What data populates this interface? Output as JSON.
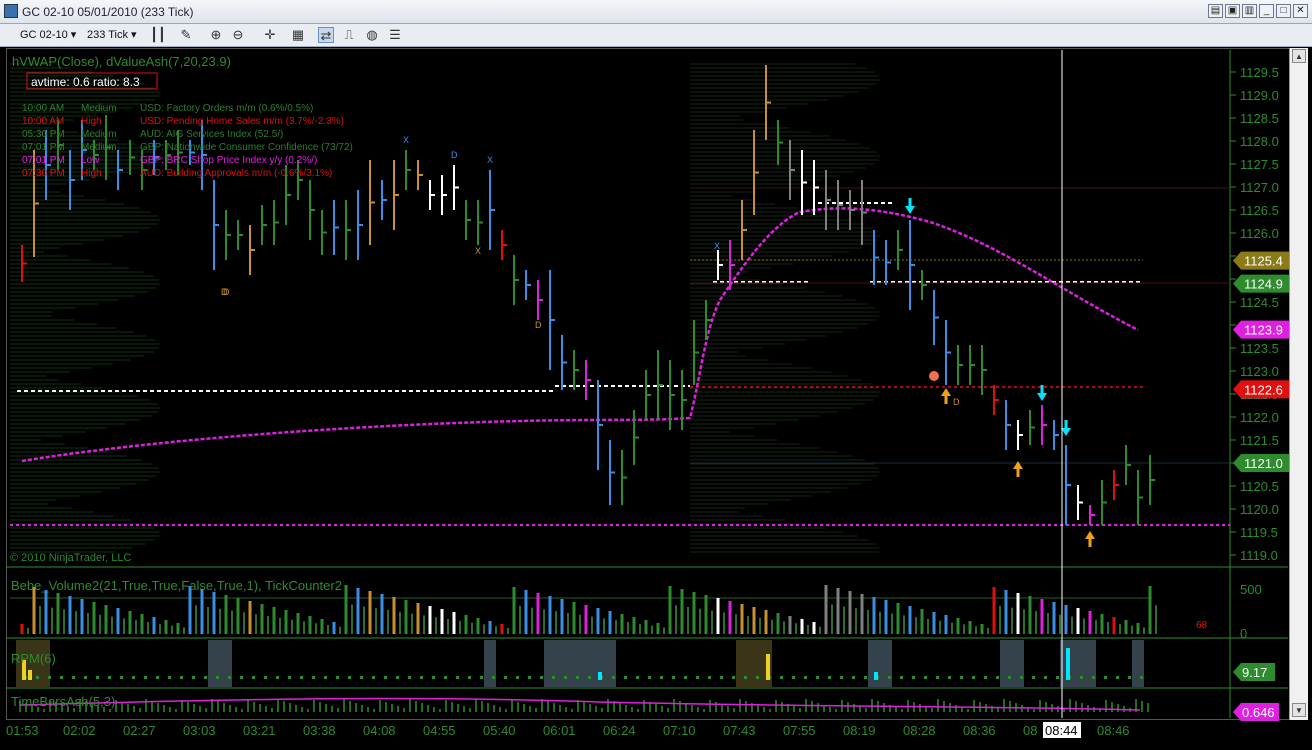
{
  "window": {
    "title": "GC 02-10  05/01/2010 (233 Tick)"
  },
  "toolbar": {
    "instrument": "GC 02-10",
    "interval": "233 Tick",
    "icons": [
      "bar-type-icon",
      "drawing-pencil-icon",
      "zoom-in-icon",
      "zoom-out-icon",
      "crosshair-icon",
      "properties-icon",
      "data-box-icon",
      "chart-trader-icon",
      "globe-icon",
      "strategy-icon"
    ]
  },
  "chart": {
    "indicator_title": "hVWAP(Close), dValueAsh(7,20,23.9)",
    "avtime_label": "avtime: 0.6 ratio: 8.3",
    "copyright": "© 2010 NinjaTrader, LLC",
    "news": [
      {
        "time": "10:00 AM",
        "impact": "Medium",
        "text": "USD: Factory Orders m/m (0.6%/0.5%)",
        "color": "#2e7d2e"
      },
      {
        "time": "10:00 AM",
        "impact": "High",
        "text": "USD: Pending Home Sales m/m (3.7%/-2.3%)",
        "color": "#e01010"
      },
      {
        "time": "05:30 PM",
        "impact": "Medium",
        "text": "AUD: AIG Services Index (52.5/)",
        "color": "#2e7d2e"
      },
      {
        "time": "07:01 PM",
        "impact": "Medium",
        "text": "GBP: Nationwide Consumer Confidence (73/72)",
        "color": "#2e7d2e"
      },
      {
        "time": "07:01 PM",
        "impact": "Low",
        "text": "GBP: BRC Shop Price Index y/y (0.2%/)",
        "color": "#e020e0"
      },
      {
        "time": "07:30 PM",
        "impact": "High",
        "text": "AUD: Building Approvals m/m (-0.6%/3.1%)",
        "color": "#e01010"
      }
    ],
    "price_ticks": [
      "1129.5",
      "1129.0",
      "1128.5",
      "1128.0",
      "1127.5",
      "1127.0",
      "1126.5",
      "1126.0",
      "1125.5",
      "1125.0",
      "1124.5",
      "1124.0",
      "1123.5",
      "1123.0",
      "1122.5",
      "1122.0",
      "1121.5",
      "1121.0",
      "1120.5",
      "1120.0",
      "1119.5",
      "1119.0"
    ],
    "price_markers": [
      {
        "value": "1125.4",
        "color": "#8a7a18"
      },
      {
        "value": "1124.9",
        "color": "#2e8b2e"
      },
      {
        "value": "1123.9",
        "color": "#e020e0"
      },
      {
        "value": "1122.6",
        "color": "#e01010"
      },
      {
        "value": "1121.0",
        "color": "#2e8b2e"
      }
    ],
    "letter_marks": [
      "D",
      "D",
      "D",
      "X",
      "X",
      "X",
      "D",
      "X",
      "D"
    ],
    "volume_panel_title": "Bebe_Volume2(21,True,True,False,True,1), TickCounter2",
    "volume_ticks": [
      "500",
      "0"
    ],
    "tick_counter": "68",
    "rpm_title": "RPM(6)",
    "rpm_value": "9.17",
    "timebars_title": "TimeBarsAsh(5,3)",
    "timebars_value": "0.646",
    "time_axis": [
      "01:53",
      "02:02",
      "02:27",
      "03:03",
      "03:21",
      "03:38",
      "04:08",
      "04:55",
      "05:40",
      "06:01",
      "06:24",
      "07:10",
      "07:43",
      "07:55",
      "08:19",
      "08:28",
      "08:36",
      "08",
      "08:46"
    ],
    "cursor_time": "08:44"
  },
  "colors": {
    "up_bar": "#2e8b2e",
    "down_bar": "#3a8ee8",
    "neutral_bar": "#c89030",
    "magenta": "#e020e0",
    "red": "#e01010",
    "grid_text": "#2e8b2e"
  }
}
